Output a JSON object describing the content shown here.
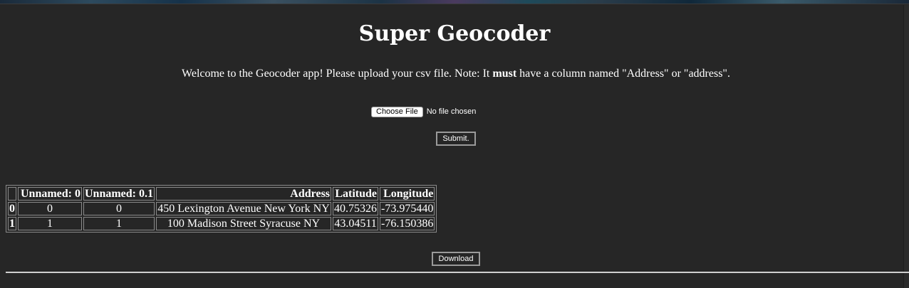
{
  "header": {
    "title": "Super Geocoder",
    "welcome_before": "Welcome to the Geocoder app! Please upload your csv file. Note: It ",
    "welcome_bold": "must",
    "welcome_after": " have a column named \"Address\" or \"address\"."
  },
  "upload": {
    "choose_label": "Choose File",
    "status": "No file chosen",
    "submit_label": "Submit."
  },
  "table": {
    "columns": [
      "",
      "Unnamed: 0",
      "Unnamed: 0.1",
      "Address",
      "Latitude",
      "Longitude"
    ],
    "rows": [
      {
        "index": "0",
        "unnamed0": "0",
        "unnamed01": "0",
        "address": "450 Lexington Avenue New York NY",
        "latitude": "40.75326",
        "longitude": "-73.975440"
      },
      {
        "index": "1",
        "unnamed0": "1",
        "unnamed01": "1",
        "address": "100 Madison Street Syracuse NY",
        "latitude": "43.04511",
        "longitude": "-76.150386"
      }
    ]
  },
  "actions": {
    "download_label": "Download"
  },
  "colors": {
    "background": "#262626",
    "text": "#ffffff",
    "border": "#8a8a8a"
  }
}
